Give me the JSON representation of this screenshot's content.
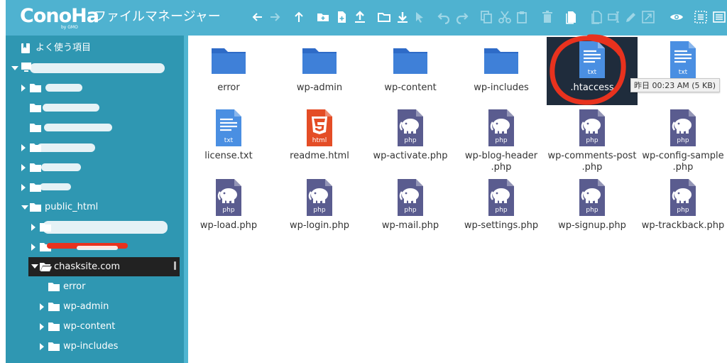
{
  "app": {
    "logo_text": "ConoHa",
    "logo_sub": "by GMO",
    "title": "ファイルマネージャー"
  },
  "toolbar": {
    "icons": [
      "arrow-left-icon",
      "arrow-right-icon",
      "arrow-up-icon",
      "new-folder-icon",
      "new-file-icon",
      "upload-icon",
      "open-folder-icon",
      "download-icon",
      "cursor-icon",
      "undo-icon",
      "redo-icon",
      "copy-icon",
      "cut-icon",
      "paste-icon",
      "trash-icon",
      "duplicate-icon",
      "doc-icon",
      "rename-icon",
      "edit-icon",
      "resize-icon",
      "view-icon",
      "select-all-icon",
      "menu-icon"
    ]
  },
  "sidebar": {
    "favorites_label": "よく使う項目",
    "server_label": "",
    "public_html_label": "public_html",
    "selected_label": "chasksite.com",
    "children": [
      "error",
      "wp-admin",
      "wp-content",
      "wp-includes"
    ]
  },
  "files": [
    {
      "name": "error",
      "type": "folder"
    },
    {
      "name": "wp-admin",
      "type": "folder"
    },
    {
      "name": "wp-content",
      "type": "folder"
    },
    {
      "name": "wp-includes",
      "type": "folder"
    },
    {
      "name": ".htaccess",
      "type": "txt",
      "selected": true
    },
    {
      "name": "",
      "type": "txt"
    },
    {
      "name": "license.txt",
      "type": "txt"
    },
    {
      "name": "readme.html",
      "type": "html"
    },
    {
      "name": "wp-activate.php",
      "type": "php"
    },
    {
      "name": "wp-blog-header\n.php",
      "type": "php"
    },
    {
      "name": "wp-comments-post\n.php",
      "type": "php"
    },
    {
      "name": "wp-config-sample\n.php",
      "type": "php"
    },
    {
      "name": "wp-load.php",
      "type": "php"
    },
    {
      "name": "wp-login.php",
      "type": "php"
    },
    {
      "name": "wp-mail.php",
      "type": "php"
    },
    {
      "name": "wp-settings.php",
      "type": "php"
    },
    {
      "name": "wp-signup.php",
      "type": "php"
    },
    {
      "name": "wp-trackback.php",
      "type": "php"
    }
  ],
  "file_badges": {
    "txt": "txt",
    "html": "html",
    "php": "php"
  },
  "tooltip": "昨日 00:23 AM (5 KB)",
  "colors": {
    "header": "#4fb2d0",
    "sidebar": "#2f97b2",
    "folder": "#2e6bc7",
    "txt": "#4a8fe2",
    "html": "#e44d26",
    "php": "#5a5c8f",
    "selection": "#1f2c3c",
    "annotation": "#e8321e"
  }
}
